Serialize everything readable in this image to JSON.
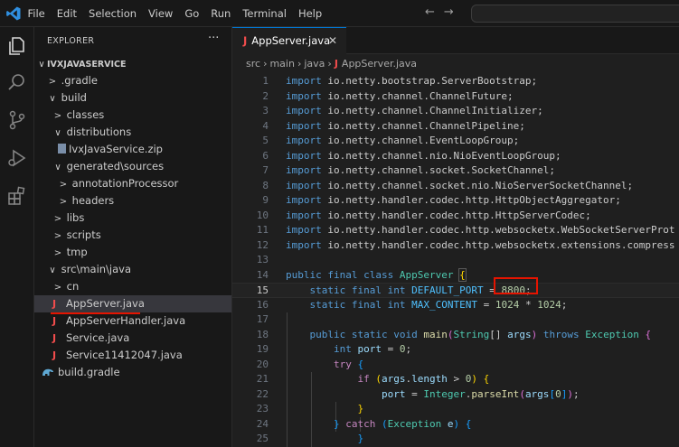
{
  "menu": [
    "File",
    "Edit",
    "Selection",
    "View",
    "Go",
    "Run",
    "Terminal",
    "Help"
  ],
  "nav": {
    "back": "←",
    "forward": "→"
  },
  "accent_color": "#0078d4",
  "highlight_color": "#e51400",
  "activity_icons": [
    "explorer-icon",
    "search-icon",
    "source-control-icon",
    "run-debug-icon",
    "extensions-icon"
  ],
  "explorer": {
    "title": "EXPLORER",
    "more": "···",
    "items": [
      {
        "label": "IVXJAVASERVICE",
        "chev": "∨"
      },
      {
        "label": ".gradle",
        "chev": ">"
      },
      {
        "label": "build",
        "chev": "∨"
      },
      {
        "label": "classes",
        "chev": ">"
      },
      {
        "label": "distributions",
        "chev": "∨"
      },
      {
        "label": "IvxJavaService.zip",
        "chev": ""
      },
      {
        "label": "generated\\sources",
        "chev": "∨"
      },
      {
        "label": "annotationProcessor",
        "chev": ">"
      },
      {
        "label": "headers",
        "chev": ">"
      },
      {
        "label": "libs",
        "chev": ">"
      },
      {
        "label": "scripts",
        "chev": ">"
      },
      {
        "label": "tmp",
        "chev": ">"
      },
      {
        "label": "src\\main\\java",
        "chev": "∨"
      },
      {
        "label": "cn",
        "chev": ">"
      },
      {
        "label": "AppServer.java",
        "chev": ""
      },
      {
        "label": "AppServerHandler.java",
        "chev": ""
      },
      {
        "label": "Service.java",
        "chev": ""
      },
      {
        "label": "Service11412047.java",
        "chev": ""
      },
      {
        "label": "build.gradle",
        "chev": ""
      }
    ]
  },
  "editor": {
    "tab": {
      "icon": "J",
      "label": "AppServer.java",
      "close": "✕"
    },
    "breadcrumb": {
      "src": "src",
      "main": "main",
      "java": "java",
      "icon": "J",
      "file": "AppServer.java"
    },
    "line_numbers": [
      "1",
      "2",
      "3",
      "4",
      "5",
      "6",
      "7",
      "8",
      "9",
      "10",
      "11",
      "12",
      "13",
      "14",
      "15",
      "16",
      "17",
      "18",
      "19",
      "20",
      "21",
      "22",
      "23",
      "24",
      "25"
    ],
    "imports": [
      "io.netty.bootstrap.ServerBootstrap;",
      "io.netty.channel.ChannelFuture;",
      "io.netty.channel.ChannelInitializer;",
      "io.netty.channel.ChannelPipeline;",
      "io.netty.channel.EventLoopGroup;",
      "io.netty.channel.nio.NioEventLoopGroup;",
      "io.netty.channel.socket.SocketChannel;",
      "io.netty.channel.socket.nio.NioServerSocketChannel;",
      "io.netty.handler.codec.http.HttpObjectAggregator;",
      "io.netty.handler.codec.http.HttpServerCodec;",
      "io.netty.handler.codec.http.websocketx.WebSocketServerProt",
      "io.netty.handler.codec.http.websocketx.extensions.compress"
    ],
    "kw": {
      "import": "import",
      "public": "public",
      "final": "final",
      "class": "class",
      "static": "static",
      "int": "int",
      "void": "void",
      "throws": "throws",
      "if": "if",
      "try": "try",
      "catch": "catch"
    },
    "names": {
      "className": "AppServer",
      "defaultPort": "DEFAULT_PORT",
      "maxContent": "MAX_CONTENT",
      "main": "main",
      "String": "String",
      "args": "args",
      "Exception": "Exception",
      "port": "port",
      "length": "length",
      "Integer": "Integer",
      "parseInt": "parseInt",
      "e": "e"
    },
    "values": {
      "port": "8800",
      "zero": "0",
      "k": "1024",
      "idx": "0"
    }
  }
}
